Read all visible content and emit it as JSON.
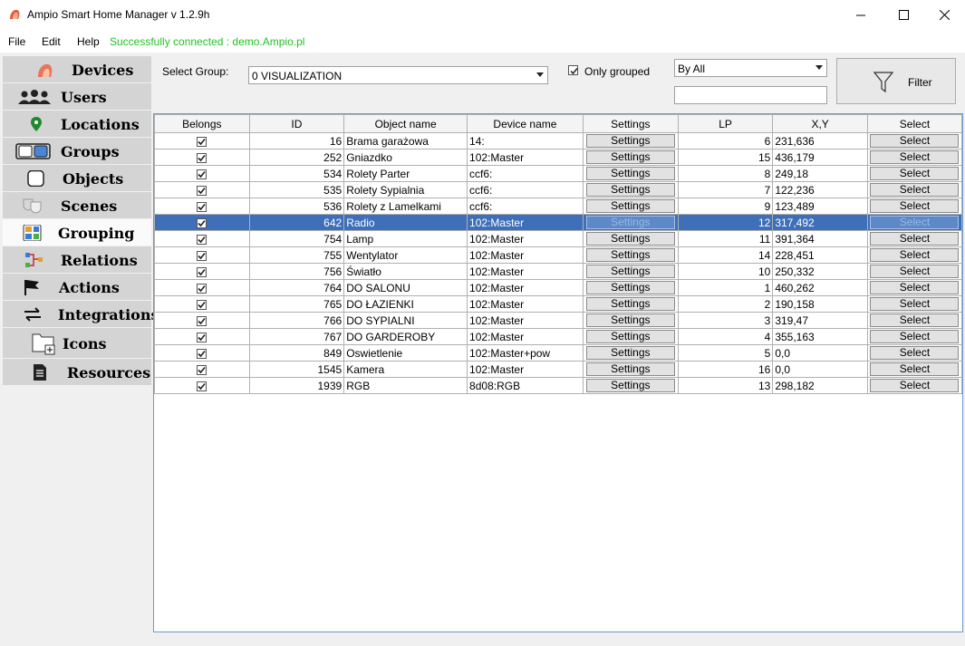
{
  "window": {
    "title": "Ampio Smart Home Manager v 1.2.9h",
    "minimize": "—",
    "maximize": "☐",
    "close": "✕"
  },
  "menu": {
    "file": "File",
    "edit": "Edit",
    "help": "Help",
    "status": "Successfully connected : demo.Ampio.pl"
  },
  "sidebar": {
    "items": [
      {
        "label": "Devices",
        "icon": "devices-icon"
      },
      {
        "label": "Users",
        "icon": "users-icon"
      },
      {
        "label": "Locations",
        "icon": "location-pin-icon"
      },
      {
        "label": "Groups",
        "icon": "groups-icon"
      },
      {
        "label": "Objects",
        "icon": "objects-icon"
      },
      {
        "label": "Scenes",
        "icon": "scenes-masks-icon"
      },
      {
        "label": "Grouping",
        "icon": "grouping-icon",
        "active": true
      },
      {
        "label": "Relations",
        "icon": "relations-icon"
      },
      {
        "label": "Actions",
        "icon": "flag-icon"
      },
      {
        "label": "Integrations",
        "icon": "swap-arrows-icon"
      },
      {
        "label": "Icons",
        "icon": "folder-add-icon"
      },
      {
        "label": "Resources",
        "icon": "document-icon"
      }
    ]
  },
  "filters": {
    "select_group_label": "Select Group:",
    "group_value": "0 VISUALIZATION",
    "only_grouped_label": "Only grouped",
    "only_grouped_checked": true,
    "by_value": "By All",
    "search_value": "",
    "filter_button": "Filter"
  },
  "table": {
    "columns": [
      "Belongs",
      "ID",
      "Object name",
      "Device name",
      "Settings",
      "LP",
      "X,Y",
      "Select"
    ],
    "settings_button": "Settings",
    "select_button": "Select",
    "selected_index": 5,
    "rows": [
      {
        "belongs": true,
        "id": "16",
        "name": "Brama garażowa",
        "device": "14:",
        "lp": "6",
        "xy": "231,636"
      },
      {
        "belongs": true,
        "id": "252",
        "name": "Gniazdko",
        "device": "102:Master",
        "lp": "15",
        "xy": "436,179"
      },
      {
        "belongs": true,
        "id": "534",
        "name": "Rolety Parter",
        "device": "ccf6:",
        "lp": "8",
        "xy": "249,18"
      },
      {
        "belongs": true,
        "id": "535",
        "name": "Rolety Sypialnia",
        "device": "ccf6:",
        "lp": "7",
        "xy": "122,236"
      },
      {
        "belongs": true,
        "id": "536",
        "name": "Rolety z Lamelkami",
        "device": "ccf6:",
        "lp": "9",
        "xy": "123,489"
      },
      {
        "belongs": true,
        "id": "642",
        "name": "Radio",
        "device": "102:Master",
        "lp": "12",
        "xy": "317,492"
      },
      {
        "belongs": true,
        "id": "754",
        "name": "Lamp",
        "device": "102:Master",
        "lp": "11",
        "xy": "391,364"
      },
      {
        "belongs": true,
        "id": "755",
        "name": "Wentylator",
        "device": "102:Master",
        "lp": "14",
        "xy": "228,451"
      },
      {
        "belongs": true,
        "id": "756",
        "name": "Światło",
        "device": "102:Master",
        "lp": "10",
        "xy": "250,332"
      },
      {
        "belongs": true,
        "id": "764",
        "name": "DO SALONU",
        "device": "102:Master",
        "lp": "1",
        "xy": "460,262"
      },
      {
        "belongs": true,
        "id": "765",
        "name": "DO ŁAZIENKI",
        "device": "102:Master",
        "lp": "2",
        "xy": "190,158"
      },
      {
        "belongs": true,
        "id": "766",
        "name": "DO SYPIALNI",
        "device": "102:Master",
        "lp": "3",
        "xy": "319,47"
      },
      {
        "belongs": true,
        "id": "767",
        "name": "DO GARDEROBY",
        "device": "102:Master",
        "lp": "4",
        "xy": "355,163"
      },
      {
        "belongs": true,
        "id": "849",
        "name": "Oswietlenie",
        "device": "102:Master+pow",
        "lp": "5",
        "xy": "0,0"
      },
      {
        "belongs": true,
        "id": "1545",
        "name": "Kamera",
        "device": "102:Master",
        "lp": "16",
        "xy": "0,0"
      },
      {
        "belongs": true,
        "id": "1939",
        "name": "RGB",
        "device": "8d08:RGB",
        "lp": "13",
        "xy": "298,182"
      }
    ]
  },
  "colors": {
    "status_green": "#22c322",
    "selection_blue": "#3e6fb8",
    "grid_border": "#6a9bd1"
  }
}
